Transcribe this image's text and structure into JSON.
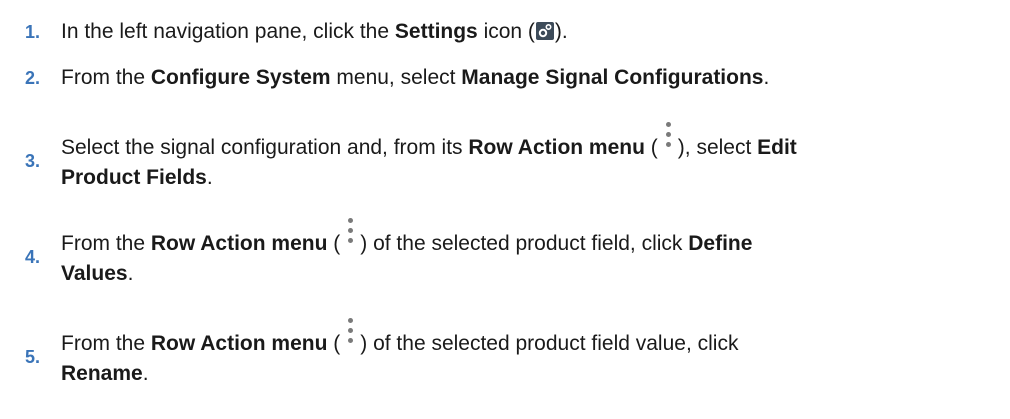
{
  "steps": [
    {
      "number": "1.",
      "parts": [
        "In the left navigation pane, click the ",
        "Settings",
        " icon (",
        ")."
      ],
      "icon": "settings-gear-icon"
    },
    {
      "number": "2.",
      "parts": [
        "From the ",
        "Configure System",
        " menu, select ",
        "Manage Signal Configurations",
        "."
      ]
    },
    {
      "number": "3.",
      "parts": [
        "Select the signal configuration and, from its ",
        "Row Action menu",
        " (",
        "), select ",
        "Edit",
        "Product Fields",
        "."
      ],
      "icon": "row-action-kebab-icon"
    },
    {
      "number": "4.",
      "parts": [
        "From the ",
        "Row Action menu",
        " (",
        ") of the selected product field, click ",
        "Define",
        "Values",
        "."
      ],
      "icon": "row-action-kebab-icon"
    },
    {
      "number": "5.",
      "parts": [
        "From the ",
        "Row Action menu",
        " (",
        ") of the selected product field value, click",
        "Rename",
        "."
      ],
      "icon": "row-action-kebab-icon"
    }
  ]
}
